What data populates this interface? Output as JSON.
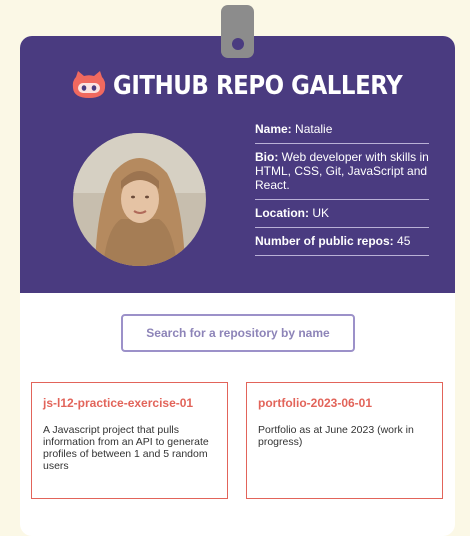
{
  "header": {
    "title": "GITHUB REPO GALLERY",
    "logo_icon": "github-octocat-icon",
    "accent_color": "#4a3b80",
    "logo_color": "#f0695f"
  },
  "profile": {
    "name_label": "Name:",
    "name_value": "Natalie",
    "bio_label": "Bio:",
    "bio_value": "Web developer with skills in HTML, CSS, Git, JavaScript and React.",
    "location_label": "Location:",
    "location_value": "UK",
    "repos_label": "Number of public repos:",
    "repos_value": "45"
  },
  "search": {
    "placeholder": "Search for a repository by name"
  },
  "repos": [
    {
      "name": "js-l12-practice-exercise-01",
      "description": "A Javascript project that pulls information from an API to generate profiles of between 1 and 5 random users"
    },
    {
      "name": "portfolio-2023-06-01",
      "description": "Portfolio as at June 2023 (work in progress)"
    }
  ]
}
